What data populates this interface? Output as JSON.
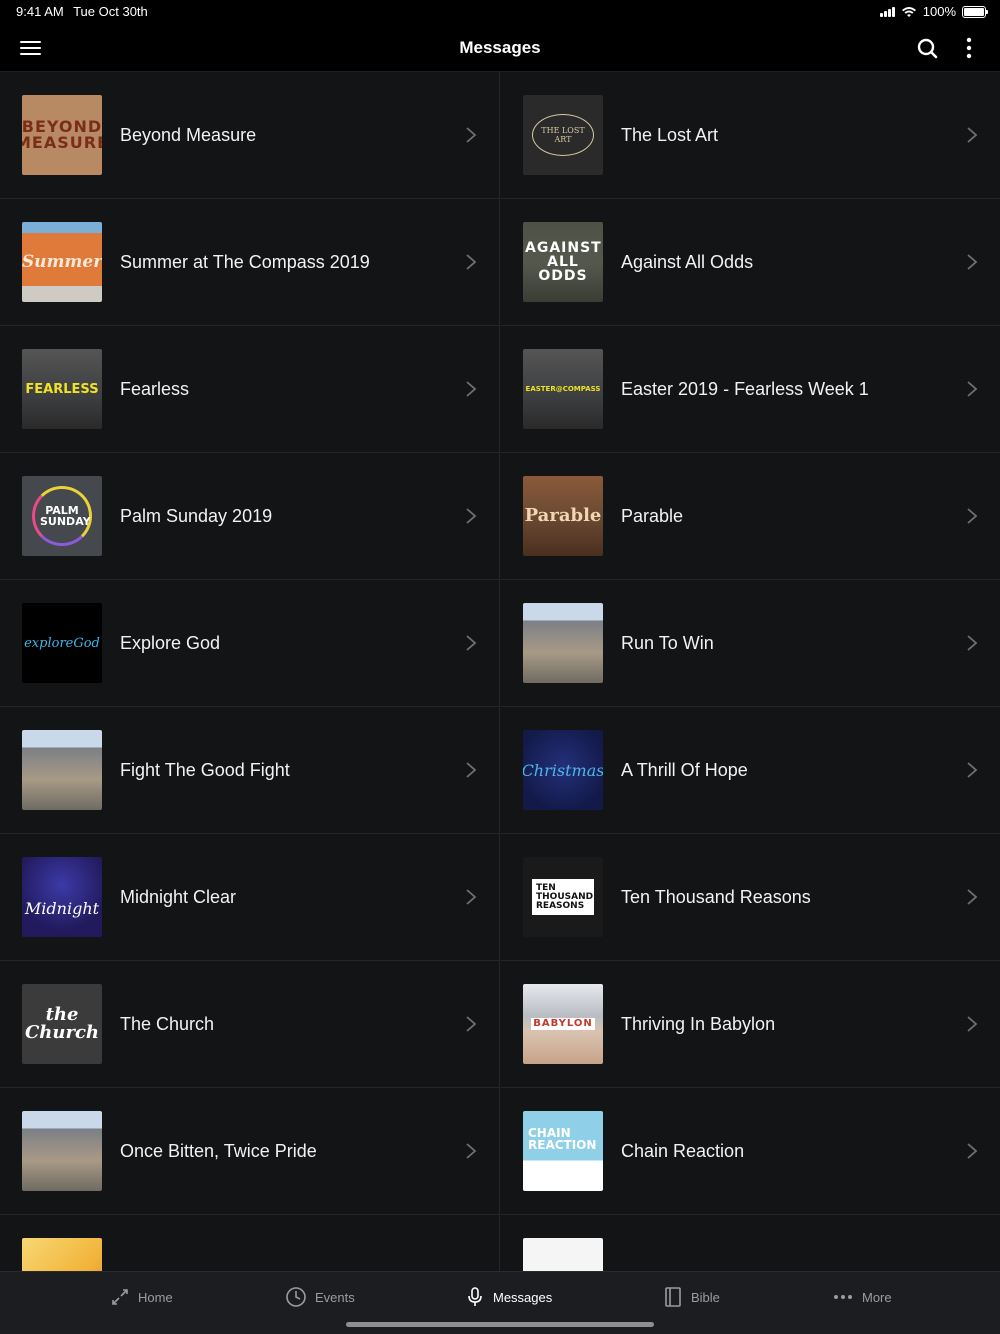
{
  "status": {
    "time": "9:41 AM",
    "date": "Tue Oct 30th",
    "battery": "100%",
    "battery_level": 1.0
  },
  "header": {
    "title": "Messages"
  },
  "left_items": [
    {
      "label": "Beyond Measure",
      "thumb_text": "BEYOND MEASURE",
      "thumb_bg": "#b88a63",
      "thumb_fg": "#7a2e1a"
    },
    {
      "label": "Summer at The Compass 2019",
      "thumb_text": "Summer",
      "thumb_bg": "#e07a3b",
      "thumb_fg": "#f7e9d6"
    },
    {
      "label": "Fearless",
      "thumb_text": "FEARLESS",
      "thumb_bg": "#3d3e40",
      "thumb_fg": "#f0e224"
    },
    {
      "label": "Palm Sunday 2019",
      "thumb_text": "PALM SUNDAY",
      "thumb_bg": "#45484c",
      "thumb_fg": "#ffffff"
    },
    {
      "label": "Explore God",
      "thumb_text": "exploreGod",
      "thumb_bg": "#000000",
      "thumb_fg": "#3fb5e6"
    },
    {
      "label": "Fight The Good Fight",
      "thumb_text": "",
      "thumb_bg": "#8a8f96",
      "thumb_fg": "#ffffff"
    },
    {
      "label": "Midnight Clear",
      "thumb_text": "Midnight",
      "thumb_bg": "#221a5c",
      "thumb_fg": "#ffffff"
    },
    {
      "label": "The Church",
      "thumb_text": "the Church",
      "thumb_bg": "#3b3b3b",
      "thumb_fg": "#ffffff"
    },
    {
      "label": "Once Bitten, Twice Pride",
      "thumb_text": "",
      "thumb_bg": "#8a8f96",
      "thumb_fg": "#ffffff"
    },
    {
      "label": "",
      "thumb_text": "",
      "thumb_bg": "#f2b33a",
      "thumb_fg": "#ffffff"
    }
  ],
  "right_items": [
    {
      "label": "The Lost Art",
      "thumb_text": "THE LOST ART",
      "thumb_bg": "#2a2a2a",
      "thumb_fg": "#d9c9a3"
    },
    {
      "label": "Against All Odds",
      "thumb_text": "AGAINST ALL ODDS",
      "thumb_bg": "#55594d",
      "thumb_fg": "#ffffff"
    },
    {
      "label": "Easter 2019 - Fearless Week 1",
      "thumb_text": "EASTER@COMPASS",
      "thumb_bg": "#3d3e40",
      "thumb_fg": "#f0e224"
    },
    {
      "label": "Parable",
      "thumb_text": "Parable",
      "thumb_bg": "#6b4a33",
      "thumb_fg": "#f1d6b2"
    },
    {
      "label": "Run To Win",
      "thumb_text": "",
      "thumb_bg": "#8a8f96",
      "thumb_fg": "#ffffff"
    },
    {
      "label": "A Thrill Of Hope",
      "thumb_text": "Christmas",
      "thumb_bg": "#131a4a",
      "thumb_fg": "#4fb6e8"
    },
    {
      "label": "Ten Thousand Reasons",
      "thumb_text": "TEN THOUSAND REASONS",
      "thumb_bg": "#1a1a1a",
      "thumb_fg": "#111111"
    },
    {
      "label": "Thriving In Babylon",
      "thumb_text": "BABYLON",
      "thumb_bg": "#d8c3b0",
      "thumb_fg": "#c0392b"
    },
    {
      "label": "Chain Reaction",
      "thumb_text": "CHAIN REACTION",
      "thumb_bg": "#8fd0e8",
      "thumb_fg": "#ffffff"
    },
    {
      "label": "",
      "thumb_text": "",
      "thumb_bg": "#f5f5f5",
      "thumb_fg": "#ffffff"
    }
  ],
  "tabs": [
    {
      "label": "Home",
      "icon": "home-arrows-icon",
      "active": false
    },
    {
      "label": "Events",
      "icon": "clock-icon",
      "active": false
    },
    {
      "label": "Messages",
      "icon": "microphone-icon",
      "active": true
    },
    {
      "label": "Bible",
      "icon": "book-icon",
      "active": false
    },
    {
      "label": "More",
      "icon": "more-dots-icon",
      "active": false
    }
  ],
  "colors": {
    "background": "#131416",
    "bar": "#000000",
    "tab_bar": "#1c1d20",
    "divider": "#26272a",
    "inactive_tab": "#9a9ca0"
  }
}
